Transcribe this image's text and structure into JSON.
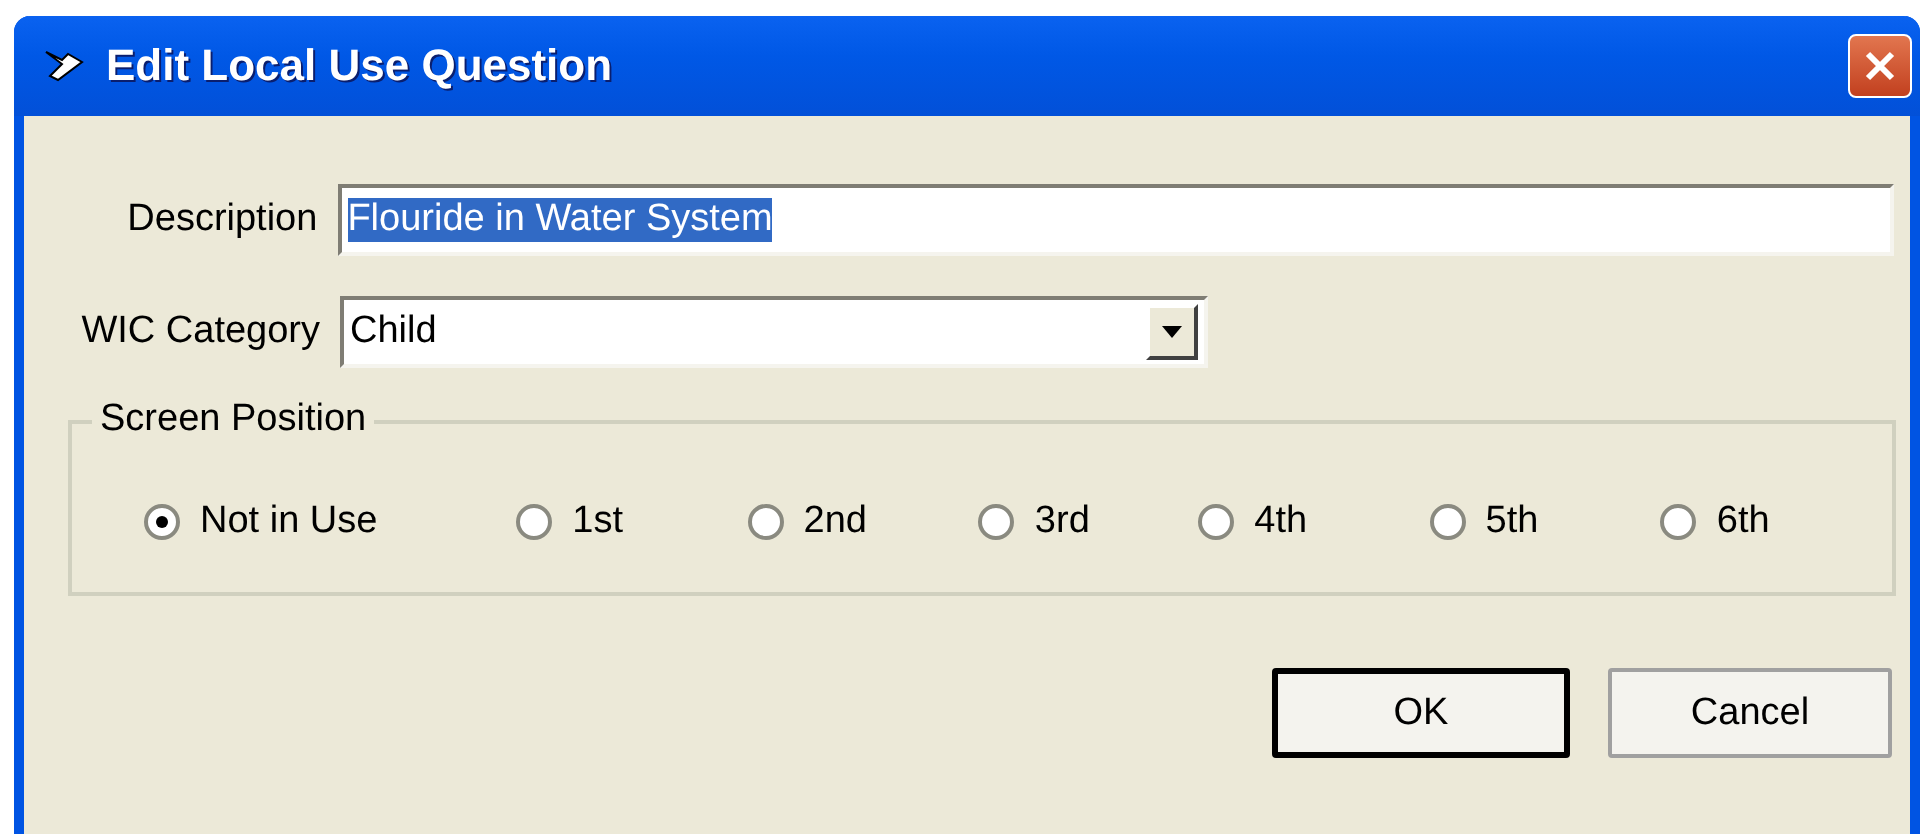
{
  "window": {
    "title": "Edit Local Use Question"
  },
  "description": {
    "label": "Description",
    "value": "Flouride in Water System",
    "highlighted": true
  },
  "wic_category": {
    "label": "WIC Category",
    "value": "Child"
  },
  "screen_position": {
    "title": "Screen Position",
    "options": [
      {
        "label": "Not in Use",
        "selected": true
      },
      {
        "label": "1st",
        "selected": false
      },
      {
        "label": "2nd",
        "selected": false
      },
      {
        "label": "3rd",
        "selected": false
      },
      {
        "label": "4th",
        "selected": false
      },
      {
        "label": "5th",
        "selected": false
      },
      {
        "label": "6th",
        "selected": false
      }
    ]
  },
  "buttons": [
    {
      "label": "OK",
      "default": true
    },
    {
      "label": "Cancel",
      "default": false
    }
  ]
}
